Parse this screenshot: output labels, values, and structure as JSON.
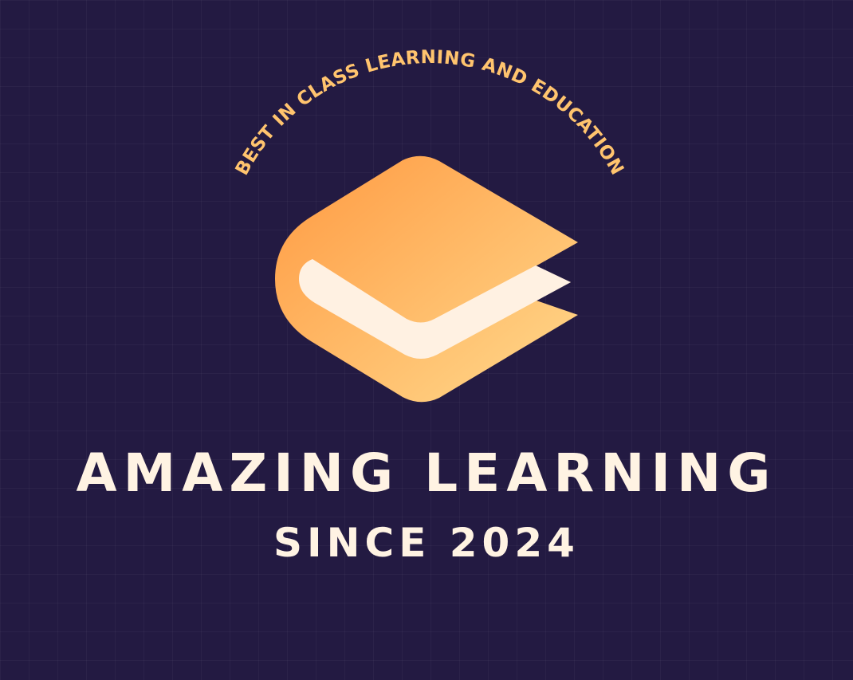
{
  "logo": {
    "tagline": "BEST IN CLASS LEARNING AND EDUCATION",
    "title": "AMAZING LEARNING",
    "subtitle": "SINCE 2024",
    "icon": "open-book-icon"
  },
  "colors": {
    "background": "#231a42",
    "text": "#fff3e3",
    "tagline": "#ffc46e",
    "book_light": "#ffd384",
    "book_dark": "#ff9e45",
    "page": "#fff1e2"
  }
}
